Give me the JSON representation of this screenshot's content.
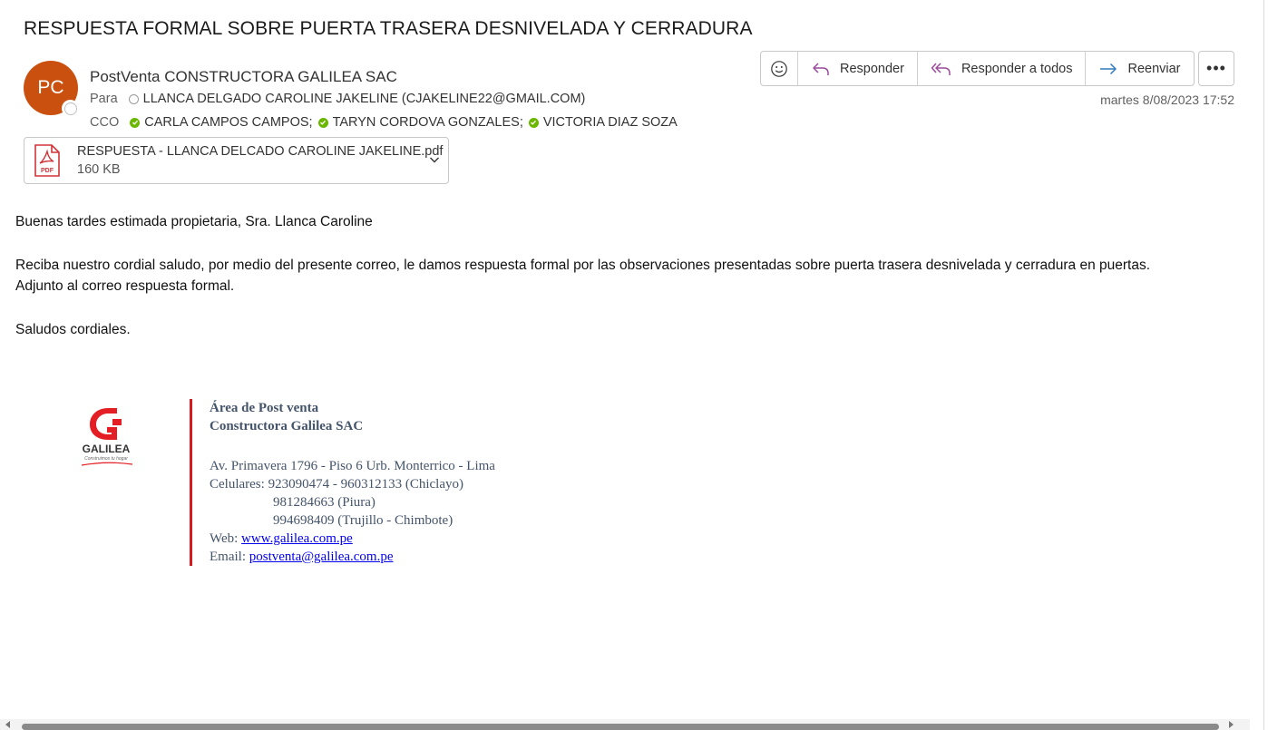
{
  "email": {
    "subject": "RESPUESTA FORMAL SOBRE PUERTA TRASERA DESNIVELADA Y CERRADURA",
    "avatar_initials": "PC",
    "avatar_color": "#ca5010",
    "sender": "PostVenta CONSTRUCTORA GALILEA SAC",
    "to_label": "Para",
    "to": [
      {
        "name": "LLANCA DELGADO CAROLINE JAKELINE (CJAKELINE22@GMAIL.COM)",
        "status": "unknown"
      }
    ],
    "cc_label": "CCO",
    "cc": [
      {
        "name": "CARLA CAMPOS CAMPOS;",
        "status": "verified"
      },
      {
        "name": "TARYN CORDOVA GONZALES;",
        "status": "verified"
      },
      {
        "name": "VICTORIA DIAZ SOZA",
        "status": "verified"
      }
    ],
    "date": "martes 8/08/2023 17:52"
  },
  "actions": {
    "emoji_icon": "smiley-icon",
    "reply": "Responder",
    "reply_all": "Responder a todos",
    "forward": "Reenviar",
    "more": "•••"
  },
  "attachment": {
    "name": "RESPUESTA - LLANCA DELCADO CAROLINE JAKELINE.pdf",
    "size": "160 KB",
    "icon_label": "PDF"
  },
  "body": {
    "greeting": "Buenas tardes estimada propietaria, Sra. Llanca Caroline",
    "p1": "Reciba nuestro cordial saludo, por medio del presente correo, le damos respuesta formal por las observaciones presentadas sobre puerta trasera desnivelada y cerradura en puertas.",
    "p2": "Adjunto al correo respuesta formal.",
    "closing": "Saludos cordiales."
  },
  "signature": {
    "logo_text": "GALILEA",
    "logo_tagline": "Construimos tu hogar",
    "dept": "Área de Post venta",
    "company": "Constructora Galilea SAC",
    "address": "Av. Primavera 1796 - Piso 6 Urb. Monterrico - Lima",
    "phones_label": "Celulares:",
    "phone1": "923090474 - 960312133 (Chiclayo)",
    "phone2": "981284663 (Piura)",
    "phone3": "994698409 (Trujillo - Chimbote)",
    "web_label": "Web:",
    "web": "www.galilea.com.pe",
    "email_label": "Email:",
    "email": "postventa@galilea.com.pe",
    "accent_color": "#d71920"
  }
}
